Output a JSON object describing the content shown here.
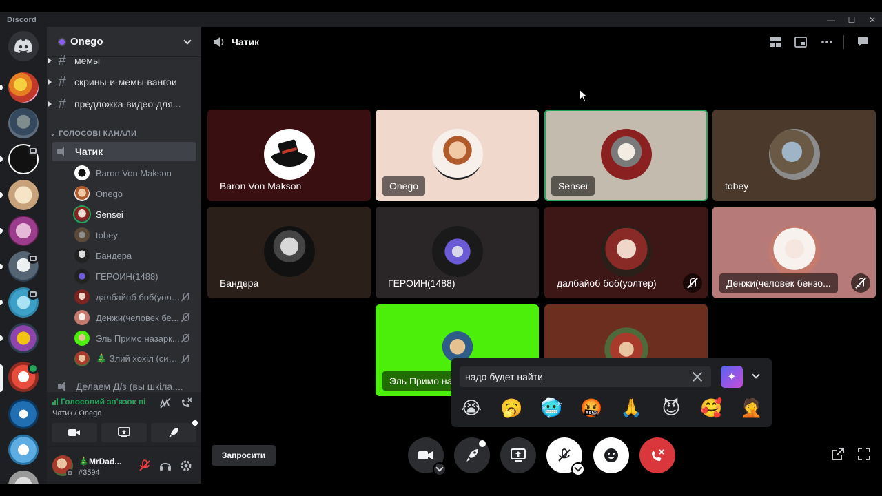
{
  "app": {
    "title": "Discord"
  },
  "server": {
    "name": "Onego"
  },
  "channels": {
    "text": [
      "мемы",
      "скрины-и-мемы-вангои",
      "предложка-видео-для..."
    ],
    "voice_category": "ГОЛОСОВІ КАНАЛИ",
    "active_voice": "Чатик",
    "voice_users": [
      {
        "name": "Baron Von Makson",
        "muted": false,
        "speaking": false
      },
      {
        "name": "Onego",
        "muted": false,
        "speaking": false
      },
      {
        "name": "Sensei",
        "muted": false,
        "speaking": true
      },
      {
        "name": "tobey",
        "muted": false,
        "speaking": false
      },
      {
        "name": "Бандера",
        "muted": false,
        "speaking": false
      },
      {
        "name": "ГЕРОИН(1488)",
        "muted": false,
        "speaking": false
      },
      {
        "name": "далбайоб боб(уолт...",
        "muted": true,
        "speaking": false
      },
      {
        "name": "Денжи(человек бе...",
        "muted": true,
        "speaking": false
      },
      {
        "name": "Эль Примо назарк...",
        "muted": true,
        "speaking": false
      },
      {
        "name": "🎄 Злий хохіл (син...",
        "muted": true,
        "speaking": false
      }
    ],
    "next_voice": "Делаем Д/з (вы шкіла,..."
  },
  "voice_panel": {
    "status": "Голосовий зв'язок пі",
    "location": "Чатик / Onego"
  },
  "user": {
    "name": "🎄MrDad...",
    "tag": "#3594"
  },
  "stage": {
    "title": "Чатик",
    "tiles": [
      {
        "label": "Baron Von Makson",
        "bg": "#3a0f12",
        "muted": false
      },
      {
        "label": "Onego",
        "bg": "#f0d8cc",
        "muted": false
      },
      {
        "label": "Sensei",
        "bg": "#c3bcae",
        "muted": false
      },
      {
        "label": "tobey",
        "bg": "#4b3a2c",
        "muted": false
      },
      {
        "label": "Бандера",
        "bg": "#2b1f1a",
        "muted": false
      },
      {
        "label": "ГЕРОИН(1488)",
        "bg": "#2a2628",
        "muted": false
      },
      {
        "label": "далбайоб боб(уолтер)",
        "bg": "#3d1716",
        "muted": true
      },
      {
        "label": "Денжи(человек бензо...",
        "bg": "#b67a78",
        "muted": true
      },
      {
        "label": "Эль Примо на",
        "bg": "#4cef0a",
        "muted": false
      },
      {
        "label": "",
        "bg": "#6b2e1f",
        "muted": false
      }
    ]
  },
  "emoji_popup": {
    "input_value": "надо будет найти",
    "emojis": [
      "😭",
      "🥱",
      "🥶",
      "🤬",
      "🙏",
      "😈",
      "🥰",
      "🤦"
    ]
  },
  "controls": {
    "invite_label": "Запросити"
  },
  "colors": {
    "accent": "#23a55a",
    "danger": "#da373c",
    "blurple": "#5865f2"
  }
}
